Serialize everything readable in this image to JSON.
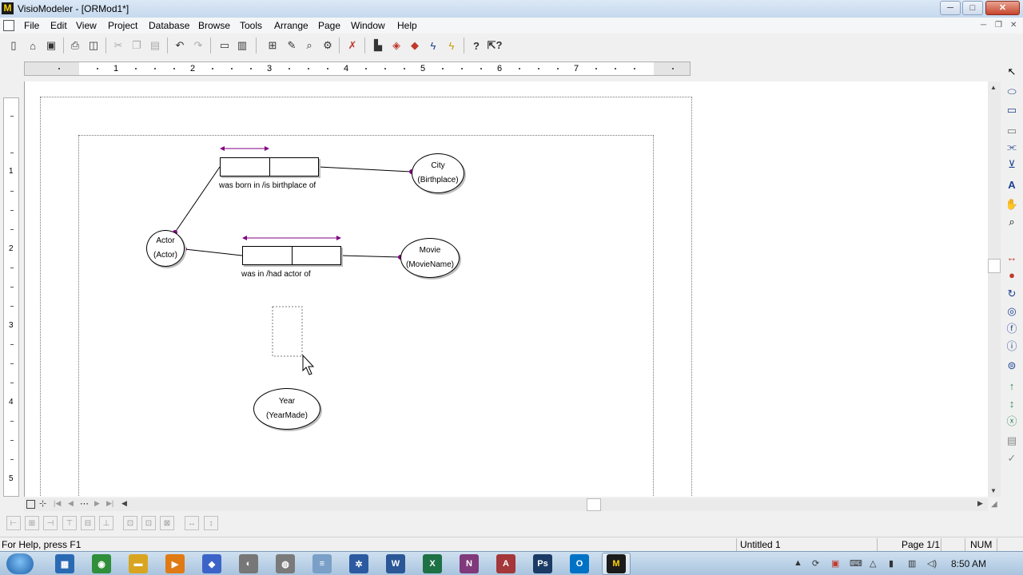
{
  "window": {
    "title": "VisioModeler - [ORMod1*]",
    "logo": "M",
    "min": "─",
    "max": "□",
    "close": "✕"
  },
  "menu": [
    "File",
    "Edit",
    "View",
    "Project",
    "Database",
    "Browse",
    "Tools",
    "Arrange",
    "Page",
    "Window",
    "Help"
  ],
  "mdi": {
    "min": "─",
    "restore": "❐",
    "close": "✕"
  },
  "toolbar_icons": [
    "new-file-icon",
    "open-file-icon",
    "save-icon",
    "print-icon",
    "print-preview-icon",
    "cut-icon",
    "copy-icon",
    "paste-icon",
    "undo-icon",
    "redo-icon",
    "new-page-icon",
    "copy-page-icon",
    "browse-icon",
    "edit-icon",
    "zoom-icon",
    "verify-icon",
    "delete-icon",
    "paint-icon",
    "generate-icon",
    "build-icon",
    "lightning-icon",
    "lightning-check-icon",
    "help-icon",
    "context-help-icon"
  ],
  "ruler": {
    "h_numbers": [
      "1",
      "2",
      "3",
      "4",
      "5",
      "6",
      "7"
    ],
    "v_numbers": [
      "1",
      "2",
      "3",
      "4",
      "5"
    ]
  },
  "diagram": {
    "entities": [
      {
        "name": "City",
        "ref": "(Birthplace)"
      },
      {
        "name": "Actor",
        "ref": "(Actor)"
      },
      {
        "name": "Movie",
        "ref": "(MovieName)"
      },
      {
        "name": "Year",
        "ref": "(YearMade)"
      }
    ],
    "facts": [
      {
        "reading": "was born in /is birthplace of"
      },
      {
        "reading": "was in /had actor of"
      }
    ]
  },
  "stencil_icons": [
    "pointer-icon",
    "entity-icon",
    "fact-icon",
    "value-icon",
    "connector-icon",
    "subtype-icon",
    "text-icon",
    "hand-icon",
    "zoom-icon",
    "uniqueness-icon",
    "mandatory-icon",
    "ring-icon",
    "equality-icon",
    "frequency-icon",
    "index-icon",
    "role-icon",
    "subset-icon",
    "range-icon",
    "exclusion-icon",
    "table-icon",
    "check-icon"
  ],
  "align_icons": [
    "align-left-icon",
    "align-center-icon",
    "align-right-icon",
    "align-top-icon",
    "align-middle-icon",
    "align-bottom-icon",
    "space-h-icon",
    "space-v-icon",
    "center-icon",
    "same-width-icon",
    "same-height-icon"
  ],
  "status": {
    "help": "For Help, press F1",
    "name": "Untitled 1",
    "page": "Page 1/1",
    "num": "NUM"
  },
  "taskbar": {
    "apps": [
      {
        "name": "explorer",
        "label": "▦",
        "color": "#2a6ab3"
      },
      {
        "name": "chrome",
        "label": "◉",
        "color": "#2f8f3a"
      },
      {
        "name": "folder",
        "label": "▬",
        "color": "#d9a520"
      },
      {
        "name": "media",
        "label": "▶",
        "color": "#e07a14"
      },
      {
        "name": "app-blue",
        "label": "◆",
        "color": "#3c64c8"
      },
      {
        "name": "app-gray",
        "label": "◐",
        "color": "#777777"
      },
      {
        "name": "app-globe",
        "label": "◍",
        "color": "#7a7a7a"
      },
      {
        "name": "notepad",
        "label": "≡",
        "color": "#7aa0c8"
      },
      {
        "name": "app-gear",
        "label": "✲",
        "color": "#2c5aa0"
      },
      {
        "name": "word",
        "label": "W",
        "color": "#2b5797"
      },
      {
        "name": "excel",
        "label": "X",
        "color": "#1e7145"
      },
      {
        "name": "onenote",
        "label": "N",
        "color": "#80397b"
      },
      {
        "name": "access",
        "label": "A",
        "color": "#a4373a"
      },
      {
        "name": "photoshop",
        "label": "Ps",
        "color": "#1b3b66"
      },
      {
        "name": "outlook",
        "label": "O",
        "color": "#0072c6"
      },
      {
        "name": "visiomodeler",
        "label": "M",
        "color": "#1b1b1b"
      }
    ],
    "clock": "8:50 AM"
  },
  "colors": {
    "role_marker": "#800080"
  }
}
